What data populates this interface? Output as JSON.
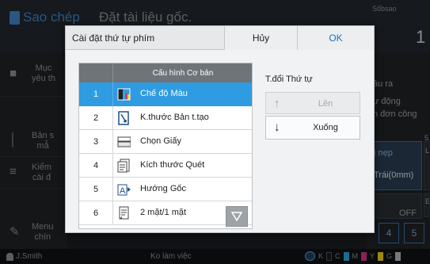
{
  "app": {
    "title": "Sao chép",
    "doc_title": "Đặt tài liệu gốc.",
    "copies_label": "Sốbsao",
    "copies_value": "1"
  },
  "left_panel": {
    "items": [
      {
        "label": "Mục\nyêu th",
        "icon": "favorite-doc-icon"
      },
      {
        "label": "Bản s\nmẫ",
        "icon": "proof-copy-icon"
      },
      {
        "label": "Kiểm\ncài đ",
        "icon": "list-icon"
      },
      {
        "label": "Menu\nchín",
        "icon": "wrench-icon"
      }
    ]
  },
  "right_panel": {
    "texts": [
      "ầu ra",
      "ự động",
      "n đơn công",
      "5",
      "ị nẹp",
      "Trái(0mm)",
      "L",
      "E",
      "OFF"
    ]
  },
  "pages": [
    "4",
    "5"
  ],
  "status": {
    "user": "J.Smith",
    "text": "Ko làm việc",
    "ink_letters": [
      "K",
      "C",
      "M",
      "Y",
      "G"
    ],
    "ink_colors": [
      "#1a1a1a",
      "#29a8e0",
      "#d8338a",
      "#f2d21a",
      "#b7bbbf"
    ]
  },
  "dialog": {
    "title": "Cài đặt thứ tự phím",
    "cancel": "Hủy",
    "ok": "OK",
    "list_header": "Cấu hình Cơ bản",
    "rows": [
      {
        "num": "1",
        "label": "Chế độ Màu",
        "icon": "color-mode-icon",
        "selected": true
      },
      {
        "num": "2",
        "label": "K.thước Bản t.tạo",
        "icon": "original-size-icon",
        "selected": false
      },
      {
        "num": "3",
        "label": "Chọn Giấy",
        "icon": "paper-tray-icon",
        "selected": false
      },
      {
        "num": "4",
        "label": "Kích thước Quét",
        "icon": "scan-size-icon",
        "selected": false
      },
      {
        "num": "5",
        "label": "Hướng Gốc",
        "icon": "orientation-icon",
        "selected": false
      },
      {
        "num": "6",
        "label": "2 mặt/1 mặt",
        "icon": "duplex-icon",
        "selected": false
      }
    ],
    "order_label": "T.đổi Thứ tự",
    "up": "Lên",
    "down": "Xuống"
  }
}
